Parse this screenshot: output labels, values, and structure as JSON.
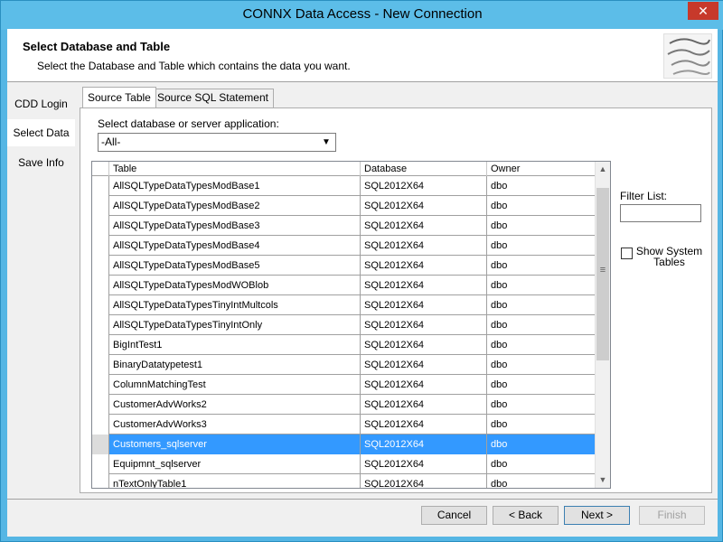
{
  "window": {
    "title": "CONNX Data Access - New Connection",
    "close_label": "✕"
  },
  "header": {
    "title": "Select Database and Table",
    "subtitle": "Select the Database and Table which contains the data you want."
  },
  "sidebar": {
    "items": [
      {
        "label": "CDD Login"
      },
      {
        "label": "Select Data"
      },
      {
        "label": "Save Info"
      }
    ]
  },
  "tabs": [
    {
      "label": "Source Table"
    },
    {
      "label": "Source SQL Statement"
    }
  ],
  "database_select": {
    "label": "Select database or server application:",
    "value": "-All-"
  },
  "grid": {
    "columns": [
      "Table",
      "Database",
      "Owner"
    ],
    "rows": [
      {
        "table": "AllSQLTypeDataTypesModBase1",
        "database": "SQL2012X64",
        "owner": "dbo"
      },
      {
        "table": "AllSQLTypeDataTypesModBase2",
        "database": "SQL2012X64",
        "owner": "dbo"
      },
      {
        "table": "AllSQLTypeDataTypesModBase3",
        "database": "SQL2012X64",
        "owner": "dbo"
      },
      {
        "table": "AllSQLTypeDataTypesModBase4",
        "database": "SQL2012X64",
        "owner": "dbo"
      },
      {
        "table": "AllSQLTypeDataTypesModBase5",
        "database": "SQL2012X64",
        "owner": "dbo"
      },
      {
        "table": "AllSQLTypeDataTypesModWOBlob",
        "database": "SQL2012X64",
        "owner": "dbo"
      },
      {
        "table": "AllSQLTypeDataTypesTinyIntMultcols",
        "database": "SQL2012X64",
        "owner": "dbo"
      },
      {
        "table": "AllSQLTypeDataTypesTinyIntOnly",
        "database": "SQL2012X64",
        "owner": "dbo"
      },
      {
        "table": "BigIntTest1",
        "database": "SQL2012X64",
        "owner": "dbo"
      },
      {
        "table": "BinaryDatatypetest1",
        "database": "SQL2012X64",
        "owner": "dbo"
      },
      {
        "table": "ColumnMatchingTest",
        "database": "SQL2012X64",
        "owner": "dbo"
      },
      {
        "table": "CustomerAdvWorks2",
        "database": "SQL2012X64",
        "owner": "dbo"
      },
      {
        "table": "CustomerAdvWorks3",
        "database": "SQL2012X64",
        "owner": "dbo"
      },
      {
        "table": "Customers_sqlserver",
        "database": "SQL2012X64",
        "owner": "dbo",
        "selected": true
      },
      {
        "table": "Equipmnt_sqlserver",
        "database": "SQL2012X64",
        "owner": "dbo"
      },
      {
        "table": "nTextOnlyTable1",
        "database": "SQL2012X64",
        "owner": "dbo"
      }
    ]
  },
  "filter": {
    "label": "Filter List:",
    "value": ""
  },
  "show_system_tables": {
    "label": "Show System Tables",
    "checked": false
  },
  "buttons": {
    "cancel": "Cancel",
    "back": "< Back",
    "next": "Next >",
    "finish": "Finish"
  }
}
